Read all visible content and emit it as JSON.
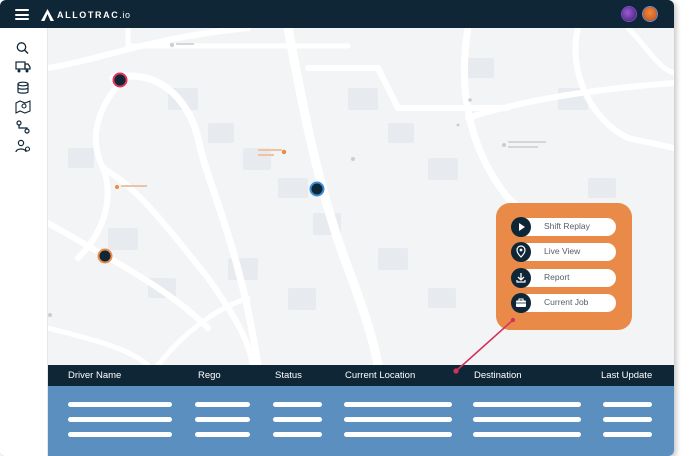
{
  "app": {
    "brand": "ALLOTRAC",
    "brand_tld": ".io"
  },
  "header": {
    "menu_icon": "hamburger-menu-icon",
    "right_icons": [
      "user-avatar-icon",
      "notification-avatar-icon"
    ]
  },
  "sidebar": {
    "items": [
      {
        "icon": "search-icon"
      },
      {
        "icon": "truck-icon"
      },
      {
        "icon": "database-icon"
      },
      {
        "icon": "map-icon"
      },
      {
        "icon": "route-icon"
      },
      {
        "icon": "user-settings-icon"
      }
    ]
  },
  "map": {
    "markers": [
      {
        "name": "driver-marker",
        "ring": "#e0315a"
      },
      {
        "name": "driver-marker",
        "ring": "#3b8fd6"
      },
      {
        "name": "driver-marker",
        "ring": "#e98a48"
      }
    ]
  },
  "context_menu": {
    "items": [
      {
        "label": "Shift Replay",
        "icon": "play-icon"
      },
      {
        "label": "Live View",
        "icon": "location-pin-icon"
      },
      {
        "label": "Report",
        "icon": "download-icon"
      },
      {
        "label": "Current Job",
        "icon": "briefcase-icon"
      }
    ]
  },
  "table": {
    "columns": [
      "Driver Name",
      "Rego",
      "Status",
      "Current Location",
      "Destination",
      "Last Update"
    ],
    "row_count": 3
  },
  "colors": {
    "navy": "#0f2637",
    "accent_orange": "#e98a48",
    "table_blue": "#5b8fbf",
    "pointer_red": "#d1345b"
  }
}
